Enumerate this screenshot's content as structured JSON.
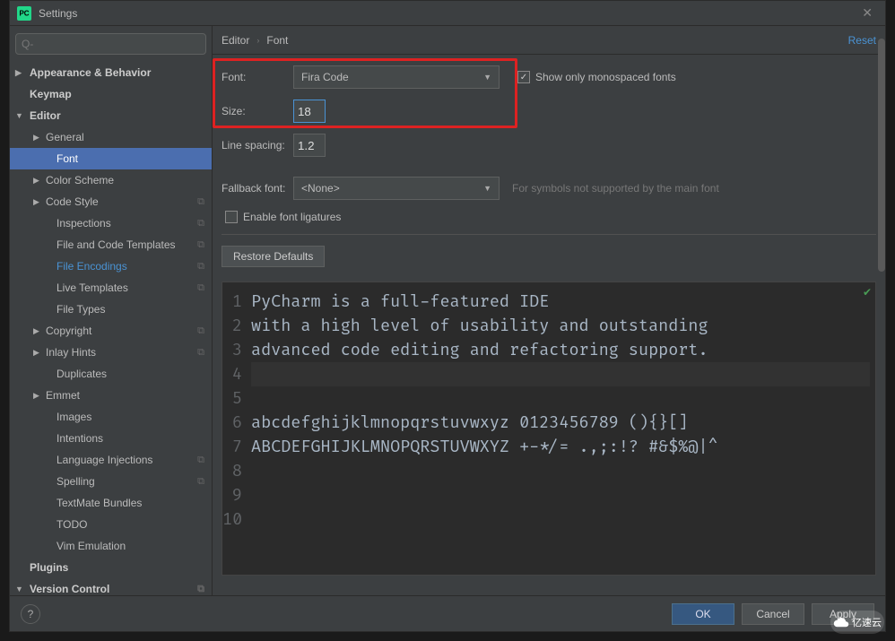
{
  "window": {
    "title": "Settings"
  },
  "search": {
    "placeholder": "Q-"
  },
  "tree": {
    "items": [
      {
        "label": "Appearance & Behavior",
        "level": 0,
        "bold": true,
        "arrow": "▶"
      },
      {
        "label": "Keymap",
        "level": 0,
        "bold": true
      },
      {
        "label": "Editor",
        "level": 0,
        "bold": true,
        "arrow": "▼"
      },
      {
        "label": "General",
        "level": 1,
        "arrow": "▶"
      },
      {
        "label": "Font",
        "level": 2,
        "selected": true
      },
      {
        "label": "Color Scheme",
        "level": 1,
        "arrow": "▶"
      },
      {
        "label": "Code Style",
        "level": 1,
        "arrow": "▶",
        "copy": true
      },
      {
        "label": "Inspections",
        "level": 2,
        "copy": true
      },
      {
        "label": "File and Code Templates",
        "level": 2,
        "copy": true
      },
      {
        "label": "File Encodings",
        "level": 2,
        "copy": true,
        "changed": true
      },
      {
        "label": "Live Templates",
        "level": 2,
        "copy": true
      },
      {
        "label": "File Types",
        "level": 2
      },
      {
        "label": "Copyright",
        "level": 1,
        "arrow": "▶",
        "copy": true
      },
      {
        "label": "Inlay Hints",
        "level": 1,
        "arrow": "▶",
        "copy": true
      },
      {
        "label": "Duplicates",
        "level": 2
      },
      {
        "label": "Emmet",
        "level": 1,
        "arrow": "▶"
      },
      {
        "label": "Images",
        "level": 2
      },
      {
        "label": "Intentions",
        "level": 2
      },
      {
        "label": "Language Injections",
        "level": 2,
        "copy": true
      },
      {
        "label": "Spelling",
        "level": 2,
        "copy": true
      },
      {
        "label": "TextMate Bundles",
        "level": 2
      },
      {
        "label": "TODO",
        "level": 2
      },
      {
        "label": "Vim Emulation",
        "level": 2
      },
      {
        "label": "Plugins",
        "level": 0,
        "bold": true
      },
      {
        "label": "Version Control",
        "level": 0,
        "bold": true,
        "arrow": "▼",
        "copy": true
      }
    ]
  },
  "breadcrumb": {
    "a": "Editor",
    "b": "Font",
    "reset": "Reset"
  },
  "form": {
    "font_label": "Font:",
    "font_value": "Fira Code",
    "size_label": "Size:",
    "size_value": "18",
    "mono_label": "Show only monospaced fonts",
    "spacing_label": "Line spacing:",
    "spacing_value": "1.2",
    "fallback_label": "Fallback font:",
    "fallback_value": "<None>",
    "fallback_hint": "For symbols not supported by the main font",
    "ligatures_label": "Enable font ligatures",
    "restore_label": "Restore Defaults"
  },
  "preview": {
    "line_numbers": [
      "1",
      "2",
      "3",
      "4",
      "5",
      "6",
      "7",
      "8",
      "9",
      "10"
    ],
    "lines": [
      "PyCharm is a full-featured IDE",
      "with a high level of usability and outstanding",
      "advanced code editing and refactoring support.",
      "",
      "abcdefghijklmnopqrstuvwxyz 0123456789 (){}[]",
      "ABCDEFGHIJKLMNOPQRSTUVWXYZ +-*/= .,;:!? #&$%@|^",
      "",
      "",
      "",
      ""
    ]
  },
  "footer": {
    "help": "?",
    "ok": "OK",
    "cancel": "Cancel",
    "apply": "Apply"
  },
  "watermark": "亿速云"
}
